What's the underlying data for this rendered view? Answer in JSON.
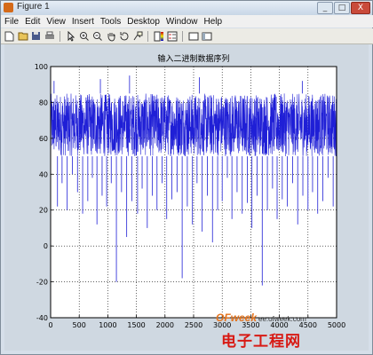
{
  "window": {
    "title": "Figure 1",
    "controls": {
      "minimize": "_",
      "maximize": "□",
      "close": "X"
    }
  },
  "menu": [
    "File",
    "Edit",
    "View",
    "Insert",
    "Tools",
    "Desktop",
    "Window",
    "Help"
  ],
  "toolbar": {
    "icons": [
      "new-file-icon",
      "open-folder-icon",
      "save-icon",
      "print-icon",
      "arrow-pointer-icon",
      "zoom-in-icon",
      "zoom-out-icon",
      "pan-hand-icon",
      "rotate-icon",
      "data-cursor-icon",
      "colorbar-icon",
      "legend-icon",
      "hide-plot-tools-icon",
      "show-plot-tools-icon"
    ]
  },
  "watermark": {
    "brand": "OFweek",
    "url": "ee.ofweek.com",
    "site": "电子工程网"
  },
  "chart_data": {
    "type": "line",
    "title": "输入二进制数据序列",
    "xlabel": "",
    "ylabel": "",
    "xlim": [
      0,
      5000
    ],
    "ylim": [
      -40,
      100
    ],
    "xticks": [
      0,
      500,
      1000,
      1500,
      2000,
      2500,
      3000,
      3500,
      4000,
      4500,
      5000
    ],
    "yticks": [
      -40,
      -20,
      0,
      20,
      40,
      60,
      80,
      100
    ],
    "grid": "dotted",
    "color": "#1f1fd6",
    "num_points": 5000,
    "band": {
      "low": 50,
      "high": 85
    },
    "spikes": [
      {
        "x": 120,
        "y": 22
      },
      {
        "x": 200,
        "y": 35
      },
      {
        "x": 290,
        "y": 20
      },
      {
        "x": 380,
        "y": 40
      },
      {
        "x": 470,
        "y": 30
      },
      {
        "x": 560,
        "y": 18
      },
      {
        "x": 650,
        "y": 25
      },
      {
        "x": 730,
        "y": 38
      },
      {
        "x": 810,
        "y": 12
      },
      {
        "x": 900,
        "y": 28
      },
      {
        "x": 980,
        "y": 22
      },
      {
        "x": 1060,
        "y": 35
      },
      {
        "x": 1150,
        "y": -20
      },
      {
        "x": 1240,
        "y": 30
      },
      {
        "x": 1330,
        "y": 5
      },
      {
        "x": 1420,
        "y": 25
      },
      {
        "x": 1520,
        "y": 18
      },
      {
        "x": 1600,
        "y": 32
      },
      {
        "x": 1690,
        "y": 10
      },
      {
        "x": 1780,
        "y": 28
      },
      {
        "x": 1860,
        "y": 20
      },
      {
        "x": 1950,
        "y": 35
      },
      {
        "x": 2030,
        "y": 15
      },
      {
        "x": 2120,
        "y": 26
      },
      {
        "x": 2210,
        "y": 30
      },
      {
        "x": 2300,
        "y": -18
      },
      {
        "x": 2390,
        "y": 22
      },
      {
        "x": 2480,
        "y": 12
      },
      {
        "x": 2560,
        "y": 35
      },
      {
        "x": 2650,
        "y": 8
      },
      {
        "x": 2740,
        "y": 28
      },
      {
        "x": 2830,
        "y": 2
      },
      {
        "x": 2920,
        "y": 20
      },
      {
        "x": 3000,
        "y": 25
      },
      {
        "x": 3090,
        "y": 38
      },
      {
        "x": 3170,
        "y": 15
      },
      {
        "x": 3260,
        "y": 30
      },
      {
        "x": 3350,
        "y": 18
      },
      {
        "x": 3440,
        "y": 24
      },
      {
        "x": 3520,
        "y": 10
      },
      {
        "x": 3610,
        "y": 28
      },
      {
        "x": 3700,
        "y": -22
      },
      {
        "x": 3790,
        "y": 20
      },
      {
        "x": 3880,
        "y": 32
      },
      {
        "x": 3960,
        "y": 15
      },
      {
        "x": 4050,
        "y": 26
      },
      {
        "x": 4140,
        "y": 22
      },
      {
        "x": 4230,
        "y": 35
      },
      {
        "x": 4320,
        "y": 12
      },
      {
        "x": 4410,
        "y": 28
      },
      {
        "x": 4500,
        "y": 20
      },
      {
        "x": 4580,
        "y": 30
      },
      {
        "x": 4670,
        "y": 18
      },
      {
        "x": 4760,
        "y": 25
      },
      {
        "x": 4850,
        "y": 38
      },
      {
        "x": 4940,
        "y": 22
      }
    ],
    "peaks": [
      {
        "x": 60,
        "y": 92
      },
      {
        "x": 870,
        "y": 93
      },
      {
        "x": 1380,
        "y": 95
      },
      {
        "x": 2600,
        "y": 94
      },
      {
        "x": 4400,
        "y": 92
      }
    ]
  }
}
